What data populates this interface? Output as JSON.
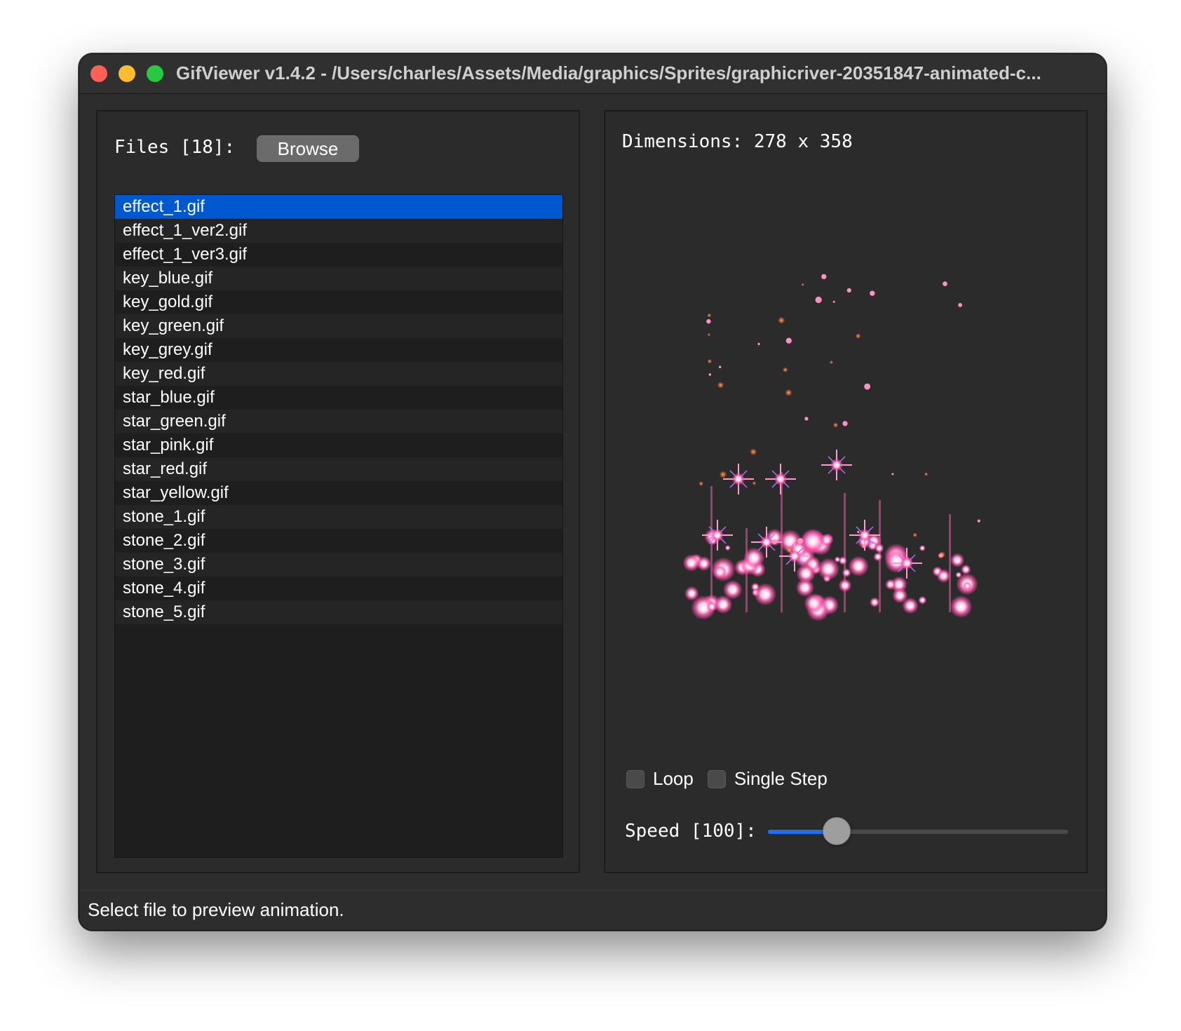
{
  "window": {
    "title": "GifViewer v1.4.2 - /Users/charles/Assets/Media/graphics/Sprites/graphicriver-20351847-animated-c..."
  },
  "files": {
    "label": "Files [18]:",
    "browse_label": "Browse",
    "selected_index": 0,
    "items": [
      "effect_1.gif",
      "effect_1_ver2.gif",
      "effect_1_ver3.gif",
      "key_blue.gif",
      "key_gold.gif",
      "key_green.gif",
      "key_grey.gif",
      "key_red.gif",
      "star_blue.gif",
      "star_green.gif",
      "star_pink.gif",
      "star_red.gif",
      "star_yellow.gif",
      "stone_1.gif",
      "stone_2.gif",
      "stone_3.gif",
      "stone_4.gif",
      "stone_5.gif"
    ]
  },
  "preview": {
    "dimensions_label": "Dimensions: 278 x 358",
    "loop_label": "Loop",
    "loop_checked": false,
    "single_step_label": "Single Step",
    "single_step_checked": false,
    "speed_label": "Speed [100]:",
    "speed_fraction": 0.23
  },
  "status": {
    "text": "Select file to preview animation."
  },
  "colors": {
    "accent": "#1f6ef0",
    "selection": "#0058d0"
  }
}
